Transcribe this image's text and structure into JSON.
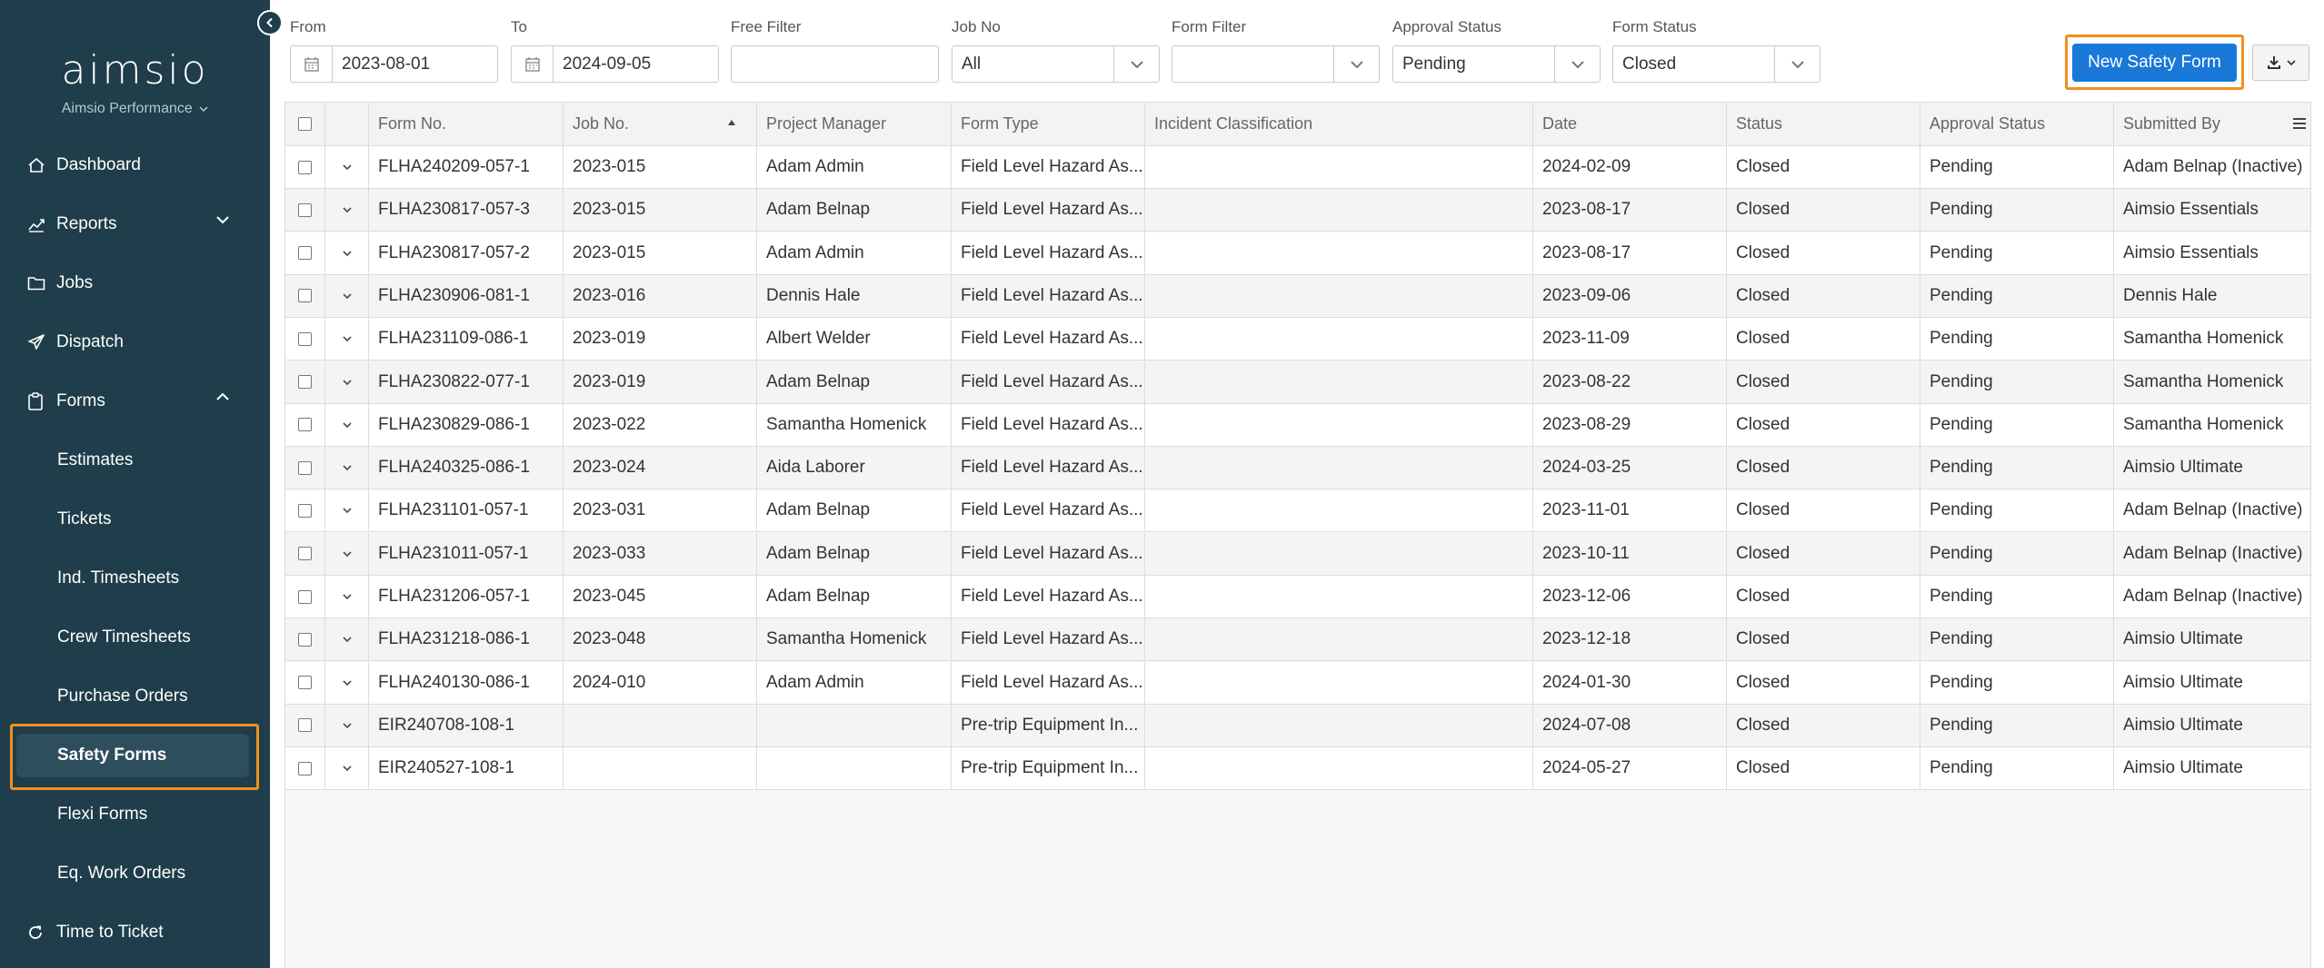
{
  "sidebar": {
    "logo": "aimsio",
    "company": "Aimsio Performance",
    "nav": {
      "dashboard": "Dashboard",
      "reports": "Reports",
      "jobs": "Jobs",
      "dispatch": "Dispatch",
      "forms": "Forms",
      "time_to_ticket": "Time to Ticket"
    },
    "forms_sub": {
      "estimates": "Estimates",
      "tickets": "Tickets",
      "ind_timesheets": "Ind. Timesheets",
      "crew_timesheets": "Crew Timesheets",
      "purchase_orders": "Purchase Orders",
      "safety_forms": "Safety Forms",
      "flexi_forms": "Flexi Forms",
      "eq_work_orders": "Eq. Work Orders"
    }
  },
  "filters": {
    "from_label": "From",
    "from_value": "2023-08-01",
    "to_label": "To",
    "to_value": "2024-09-05",
    "free_filter_label": "Free Filter",
    "free_filter_value": "",
    "job_no_label": "Job No",
    "job_no_value": "All",
    "form_filter_label": "Form Filter",
    "form_filter_value": "",
    "approval_status_label": "Approval Status",
    "approval_status_value": "Pending",
    "form_status_label": "Form Status",
    "form_status_value": "Closed"
  },
  "actions": {
    "new_safety_form": "New Safety Form"
  },
  "table": {
    "headers": {
      "form_no": "Form No.",
      "job_no": "Job No.",
      "project_manager": "Project Manager",
      "form_type": "Form Type",
      "incident_classification": "Incident Classification",
      "date": "Date",
      "status": "Status",
      "approval_status": "Approval Status",
      "submitted_by": "Submitted By"
    },
    "sort": {
      "column": "job_no",
      "direction": "ascending"
    },
    "rows": [
      {
        "form_no": "FLHA240209-057-1",
        "job_no": "2023-015",
        "pm": "Adam Admin",
        "form_type": "Field Level Hazard As...",
        "incident": "",
        "date": "2024-02-09",
        "status": "Closed",
        "approval": "Pending",
        "submitted_by": "Adam Belnap (Inactive)"
      },
      {
        "form_no": "FLHA230817-057-3",
        "job_no": "2023-015",
        "pm": "Adam Belnap",
        "form_type": "Field Level Hazard As...",
        "incident": "",
        "date": "2023-08-17",
        "status": "Closed",
        "approval": "Pending",
        "submitted_by": "Aimsio Essentials"
      },
      {
        "form_no": "FLHA230817-057-2",
        "job_no": "2023-015",
        "pm": "Adam Admin",
        "form_type": "Field Level Hazard As...",
        "incident": "",
        "date": "2023-08-17",
        "status": "Closed",
        "approval": "Pending",
        "submitted_by": "Aimsio Essentials"
      },
      {
        "form_no": "FLHA230906-081-1",
        "job_no": "2023-016",
        "pm": "Dennis Hale",
        "form_type": "Field Level Hazard As...",
        "incident": "",
        "date": "2023-09-06",
        "status": "Closed",
        "approval": "Pending",
        "submitted_by": "Dennis Hale"
      },
      {
        "form_no": "FLHA231109-086-1",
        "job_no": "2023-019",
        "pm": "Albert Welder",
        "form_type": "Field Level Hazard As...",
        "incident": "",
        "date": "2023-11-09",
        "status": "Closed",
        "approval": "Pending",
        "submitted_by": "Samantha Homenick"
      },
      {
        "form_no": "FLHA230822-077-1",
        "job_no": "2023-019",
        "pm": "Adam Belnap",
        "form_type": "Field Level Hazard As...",
        "incident": "",
        "date": "2023-08-22",
        "status": "Closed",
        "approval": "Pending",
        "submitted_by": "Samantha Homenick"
      },
      {
        "form_no": "FLHA230829-086-1",
        "job_no": "2023-022",
        "pm": "Samantha Homenick",
        "form_type": "Field Level Hazard As...",
        "incident": "",
        "date": "2023-08-29",
        "status": "Closed",
        "approval": "Pending",
        "submitted_by": "Samantha Homenick"
      },
      {
        "form_no": "FLHA240325-086-1",
        "job_no": "2023-024",
        "pm": "Aida Laborer",
        "form_type": "Field Level Hazard As...",
        "incident": "",
        "date": "2024-03-25",
        "status": "Closed",
        "approval": "Pending",
        "submitted_by": "Aimsio Ultimate"
      },
      {
        "form_no": "FLHA231101-057-1",
        "job_no": "2023-031",
        "pm": "Adam Belnap",
        "form_type": "Field Level Hazard As...",
        "incident": "",
        "date": "2023-11-01",
        "status": "Closed",
        "approval": "Pending",
        "submitted_by": "Adam Belnap (Inactive)"
      },
      {
        "form_no": "FLHA231011-057-1",
        "job_no": "2023-033",
        "pm": "Adam Belnap",
        "form_type": "Field Level Hazard As...",
        "incident": "",
        "date": "2023-10-11",
        "status": "Closed",
        "approval": "Pending",
        "submitted_by": "Adam Belnap (Inactive)"
      },
      {
        "form_no": "FLHA231206-057-1",
        "job_no": "2023-045",
        "pm": "Adam Belnap",
        "form_type": "Field Level Hazard As...",
        "incident": "",
        "date": "2023-12-06",
        "status": "Closed",
        "approval": "Pending",
        "submitted_by": "Adam Belnap (Inactive)"
      },
      {
        "form_no": "FLHA231218-086-1",
        "job_no": "2023-048",
        "pm": "Samantha Homenick",
        "form_type": "Field Level Hazard As...",
        "incident": "",
        "date": "2023-12-18",
        "status": "Closed",
        "approval": "Pending",
        "submitted_by": "Aimsio Ultimate"
      },
      {
        "form_no": "FLHA240130-086-1",
        "job_no": "2024-010",
        "pm": "Adam Admin",
        "form_type": "Field Level Hazard As...",
        "incident": "",
        "date": "2024-01-30",
        "status": "Closed",
        "approval": "Pending",
        "submitted_by": "Aimsio Ultimate"
      },
      {
        "form_no": "EIR240708-108-1",
        "job_no": "",
        "pm": "",
        "form_type": "Pre-trip Equipment In...",
        "incident": "",
        "date": "2024-07-08",
        "status": "Closed",
        "approval": "Pending",
        "submitted_by": "Aimsio Ultimate"
      },
      {
        "form_no": "EIR240527-108-1",
        "job_no": "",
        "pm": "",
        "form_type": "Pre-trip Equipment In...",
        "incident": "",
        "date": "2024-05-27",
        "status": "Closed",
        "approval": "Pending",
        "submitted_by": "Aimsio Ultimate"
      }
    ]
  },
  "icons": {
    "collapse": "chevron-left-icon",
    "dashboard": "home-icon",
    "reports": "chart-icon",
    "jobs": "folder-icon",
    "dispatch": "send-icon",
    "forms": "clipboard-icon",
    "time_to_ticket": "refresh-icon",
    "calendar": "calendar-icon",
    "download": "download-icon"
  },
  "colors": {
    "sidebar_bg": "#1f3d4a",
    "accent_button": "#1a78d9",
    "highlight": "#f0901e"
  }
}
